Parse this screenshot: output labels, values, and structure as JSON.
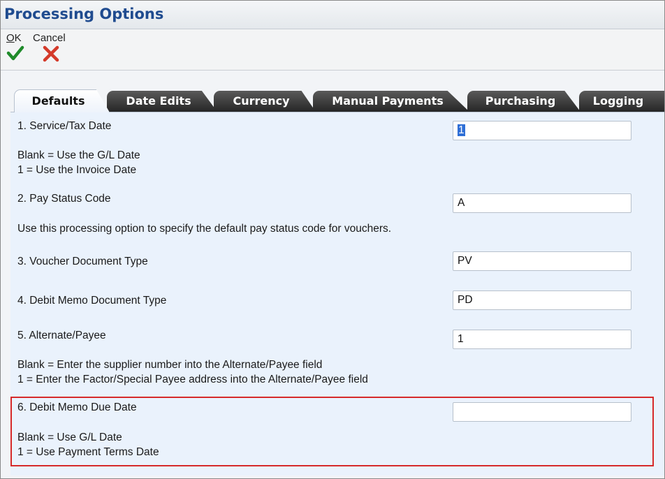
{
  "window": {
    "title": "Processing Options"
  },
  "toolbar": {
    "ok_accel": "O",
    "ok_rest": "K",
    "cancel_text": "Cancel",
    "ok_icon": "checkmark-icon",
    "cancel_icon": "red-x-icon"
  },
  "tabs": [
    {
      "label": "Defaults",
      "active": true
    },
    {
      "label": "Date Edits"
    },
    {
      "label": "Currency"
    },
    {
      "label": "Manual Payments"
    },
    {
      "label": "Purchasing"
    },
    {
      "label": "Logging"
    }
  ],
  "options": {
    "o1": {
      "label": "1. Service/Tax Date",
      "value": "1",
      "desc1": "Blank = Use the G/L Date",
      "desc2": "1 = Use the Invoice Date"
    },
    "o2": {
      "label": "2. Pay Status Code",
      "value": "A",
      "desc1": "Use this processing option to specify the default pay status code for vouchers."
    },
    "o3": {
      "label": "3. Voucher Document Type",
      "value": "PV"
    },
    "o4": {
      "label": "4. Debit Memo Document Type",
      "value": "PD"
    },
    "o5": {
      "label": "5. Alternate/Payee",
      "value": "1",
      "desc1": "Blank = Enter the supplier number into the Alternate/Payee field",
      "desc2": "1 = Enter the Factor/Special Payee address into the Alternate/Payee field"
    },
    "o6": {
      "label": "6. Debit Memo Due Date",
      "value": "",
      "desc1": "Blank = Use G/L Date",
      "desc2": "1 = Use Payment Terms Date"
    }
  },
  "colors": {
    "title": "#1f4b8f",
    "highlight": "#d62a2a",
    "panel": "#eaf2fc"
  }
}
